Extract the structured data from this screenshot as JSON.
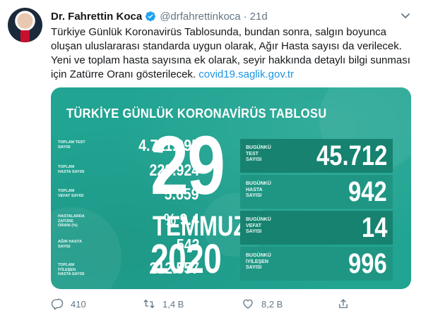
{
  "tweet": {
    "name": "Dr. Fahrettin Koca",
    "handle": "@drfahrettinkoca",
    "separator": "·",
    "time": "21d",
    "text_lines": [
      "Türkiye Günlük Koronavirüs Tablosunda, bundan sonra, salgın boyunca",
      "oluşan uluslararası standarda uygun olarak, Ağır Hasta sayısı da verilecek.",
      "Yeni ve toplam hasta sayısına ek olarak, seyir hakkında detaylı bilgi sunması",
      "için Zatürre Oranı gösterilecek."
    ],
    "link": "covid19.saglik.gov.tr"
  },
  "card": {
    "title": "TÜRKİYE GÜNLÜK KORONAVİRÜS TABLOSU",
    "left_stats": [
      {
        "label": "TOPLAM TEST SAYISI",
        "value": "4.711.095"
      },
      {
        "label": "TOPLAM HASTA SAYISI",
        "value": "228.924"
      },
      {
        "label": "TOPLAM VEFAT SAYISI",
        "value": "5.659"
      },
      {
        "label": "HASTALARDA ZATÜRE ORANI (%)",
        "value": "% 9.4"
      },
      {
        "label": "AĞIR HASTA SAYISI",
        "value": "542"
      },
      {
        "label": "TOPLAM İYİLEŞEN HASTA SAYISI",
        "value": "212.557"
      }
    ],
    "day": "29",
    "month": "TEMMUZ",
    "year": "2020",
    "right_stats": [
      {
        "label": "BUGÜNKÜ TEST SAYISI",
        "value": "45.712"
      },
      {
        "label": "BUGÜNKÜ HASTA SAYISI",
        "value": "942"
      },
      {
        "label": "BUGÜNKÜ VEFAT SAYISI",
        "value": "14"
      },
      {
        "label": "BUGÜNKÜ İYİLEŞEN SAYISI",
        "value": "996"
      }
    ]
  },
  "actions": {
    "reply_count": "410",
    "retweet_count": "1,4 B",
    "like_count": "8,2 B"
  },
  "icons": [
    "verified-icon",
    "caret-down-icon",
    "reply-icon",
    "retweet-icon",
    "like-icon",
    "share-icon"
  ],
  "colors": {
    "card_bg": "#21a492",
    "card_box_dark": "#16826f",
    "link": "#1b95e0",
    "verified": "#1da1f2",
    "muted": "#657786"
  }
}
